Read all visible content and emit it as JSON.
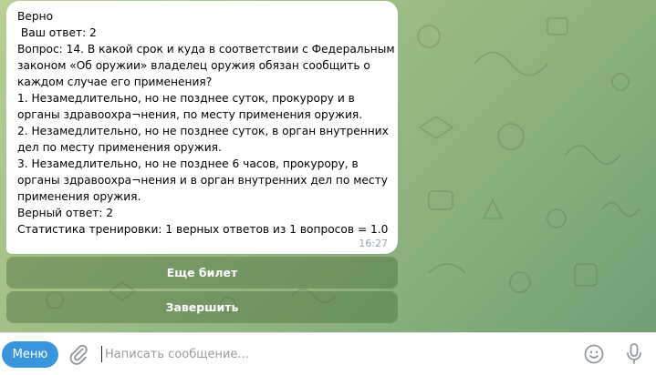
{
  "message": {
    "lines": [
      "Верно",
      " Ваш ответ: 2",
      "Вопрос: 14. В какой срок и куда в соответствии с Федеральным",
      "законом «Об оружии» владелец оружия обязан сообщить о",
      "каждом случае его применения?",
      "1. Незамедлительно, но не позднее суток, прокурору и в",
      "органы здравоохра¬нения, по месту применения оружия.",
      "2. Незамедлительно, но не позднее суток, в орган внутренних",
      "дел по месту применения оружия.",
      "3. Незамедлительно, но не позднее 6 часов, прокурору, в",
      "органы здравоохра¬нения и в орган внутренних дел по месту",
      "применения оружия.",
      "Верный ответ: 2",
      "Статистика тренировки: 1 верных ответов из 1 вопросов = 1.0"
    ],
    "time": "16:27"
  },
  "keyboard": {
    "more_ticket": "Еще билет",
    "finish": "Завершить"
  },
  "input_bar": {
    "menu_label": "Меню",
    "placeholder": "Написать сообщение..."
  },
  "icons": {
    "attach": "paperclip-icon",
    "emoji": "smile-icon",
    "mic": "microphone-icon"
  },
  "colors": {
    "accent": "#3a96dc",
    "bubble": "#ffffff",
    "keyboard_button": "#5a7d4c"
  }
}
